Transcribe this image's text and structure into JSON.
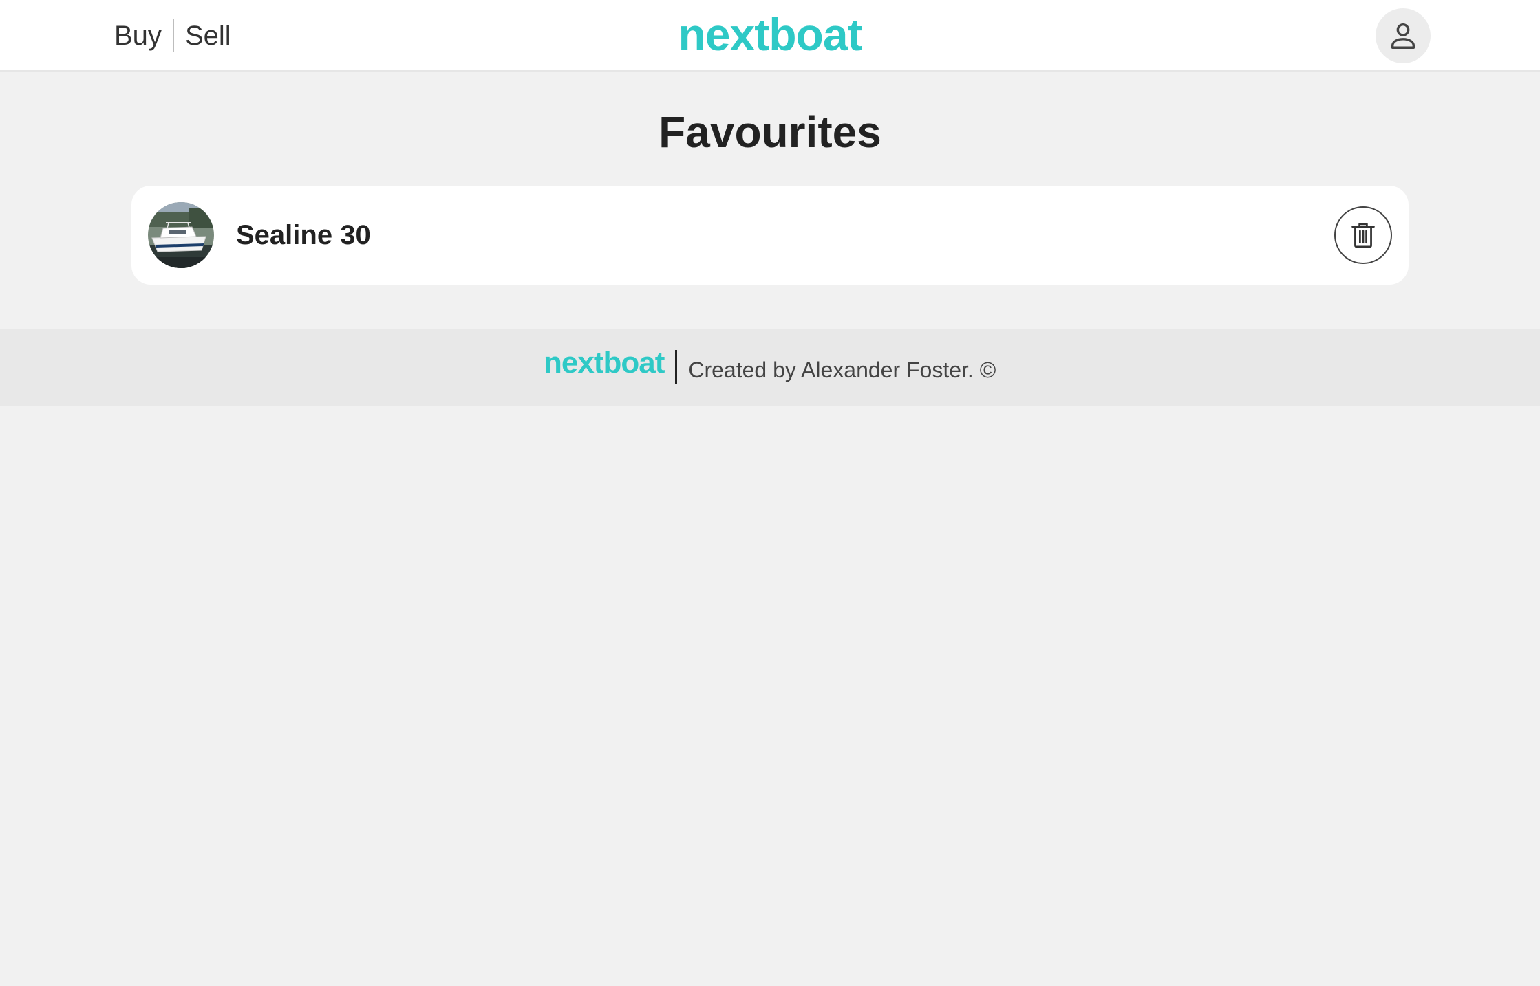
{
  "header": {
    "nav": {
      "buy_label": "Buy",
      "sell_label": "Sell"
    },
    "brand": "nextboat",
    "account_icon": "person-icon"
  },
  "main": {
    "title": "Favourites",
    "favourites": [
      {
        "name": "Sealine 30",
        "thumbnail_icon": "boat-photo",
        "delete_icon": "trash-icon"
      }
    ]
  },
  "footer": {
    "brand": "nextboat",
    "credit": "Created by Alexander Foster. ©"
  },
  "colors": {
    "brand": "#2ec9c6",
    "page_background": "#f1f1f1",
    "footer_background": "#e8e8e8"
  }
}
